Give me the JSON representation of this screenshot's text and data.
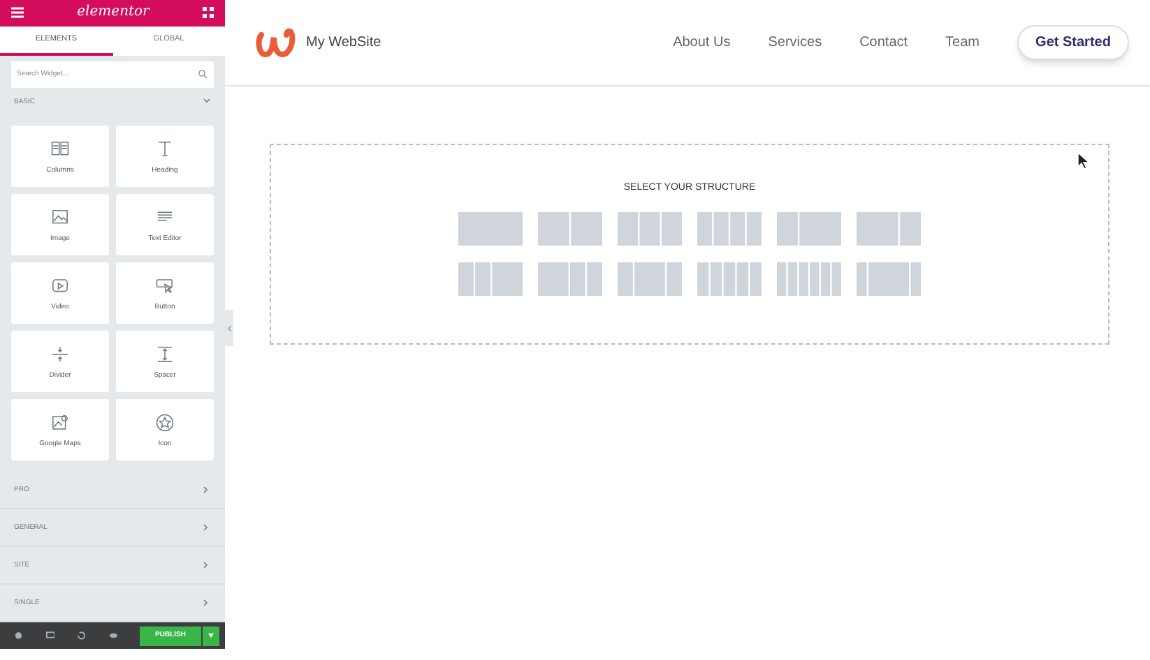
{
  "editor": {
    "logo": "elementor",
    "tabs": [
      {
        "label": "ELEMENTS",
        "selected": true
      },
      {
        "label": "GLOBAL",
        "selected": false
      }
    ],
    "search": {
      "placeholder": "Search Widget..."
    },
    "sections": [
      {
        "label": "BASIC",
        "expanded": true,
        "widgets": [
          {
            "kind": "columns",
            "label": "Columns"
          },
          {
            "kind": "heading",
            "label": "Heading"
          },
          {
            "kind": "image",
            "label": "Image"
          },
          {
            "kind": "text",
            "label": "Text Editor"
          },
          {
            "kind": "video",
            "label": "Video"
          },
          {
            "kind": "button",
            "label": "Button"
          },
          {
            "kind": "divider",
            "label": "Divider"
          },
          {
            "kind": "spacer",
            "label": "Spacer"
          },
          {
            "kind": "map",
            "label": "Google Maps"
          },
          {
            "kind": "icon",
            "label": "Icon"
          }
        ]
      },
      {
        "label": "PRO",
        "expanded": false
      },
      {
        "label": "GENERAL",
        "expanded": false
      },
      {
        "label": "SITE",
        "expanded": false
      },
      {
        "label": "SINGLE",
        "expanded": false
      }
    ],
    "publish": "PUBLISH"
  },
  "site": {
    "name": "My WebSite",
    "nav": [
      "About Us",
      "Services",
      "Contact",
      "Team"
    ],
    "cta": "Get Started",
    "structure_title": "SELECT YOUR STRUCTURE"
  }
}
